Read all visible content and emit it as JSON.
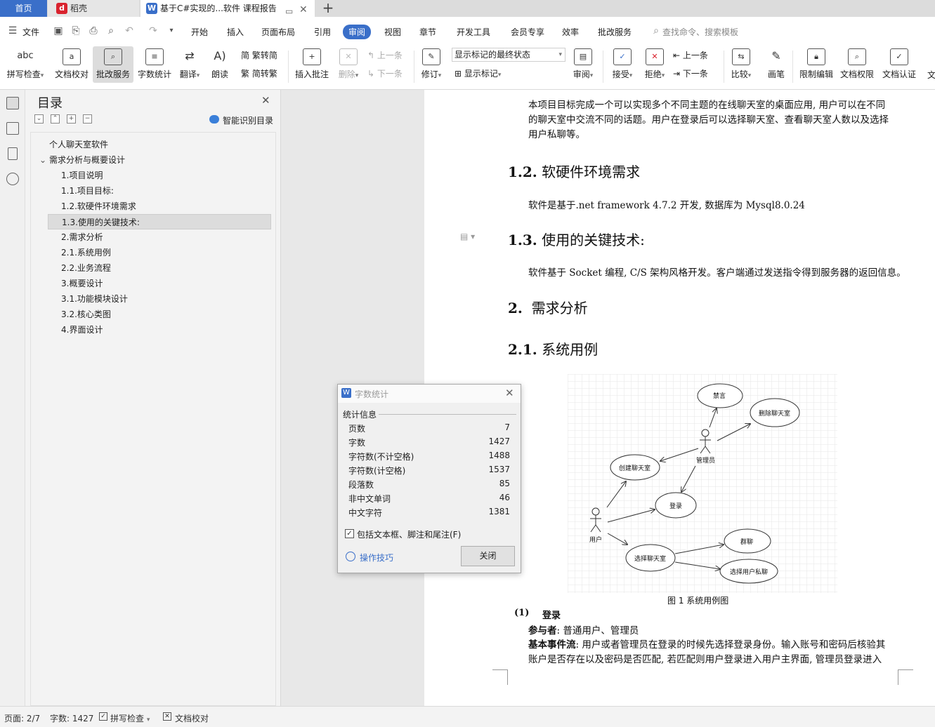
{
  "tabs": {
    "home": "首页",
    "daoke": "稻壳",
    "doc": "基于C#实现的...软件 课程报告"
  },
  "menu": {
    "file": "文件",
    "items": [
      "开始",
      "插入",
      "页面布局",
      "引用",
      "审阅",
      "视图",
      "章节",
      "开发工具",
      "会员专享",
      "效率",
      "批改服务"
    ],
    "search": "查找命令、搜索模板"
  },
  "ribbon": {
    "spell": "拼写检查",
    "proof": "文档校对",
    "review_service": "批改服务",
    "word_count": "字数统计",
    "translate": "翻译",
    "read": "朗读",
    "trad_to_simp": "繁转简",
    "simp_to_trad": "简转繁",
    "insert_comment": "插入批注",
    "delete": "删除",
    "prev": "上一条",
    "next": "下一条",
    "revise": "修订",
    "markup_state": "显示标记的最终状态",
    "show_markup": "显示标记",
    "review_pane": "审阅",
    "accept": "接受",
    "reject": "拒绝",
    "prev2": "上一条",
    "next2": "下一条",
    "compare": "比较",
    "pen": "画笔",
    "restrict": "限制编辑",
    "perm": "文档权限",
    "cert": "文档认证",
    "more": "文"
  },
  "toc": {
    "title": "目录",
    "smart": "智能识别目录",
    "items": [
      {
        "label": "个人聊天室软件",
        "level": 0
      },
      {
        "label": "需求分析与概要设计",
        "level": 0
      },
      {
        "label": "1.项目说明",
        "level": 1
      },
      {
        "label": "1.1.项目目标:",
        "level": 1
      },
      {
        "label": "1.2.软硬件环境需求",
        "level": 1
      },
      {
        "label": "1.3.使用的关键技术:",
        "level": 1
      },
      {
        "label": "2.需求分析",
        "level": 1
      },
      {
        "label": "2.1.系统用例",
        "level": 1
      },
      {
        "label": "2.2.业务流程",
        "level": 1
      },
      {
        "label": "3.概要设计",
        "level": 1
      },
      {
        "label": "3.1.功能模块设计",
        "level": 1
      },
      {
        "label": "3.2.核心类图",
        "level": 1
      },
      {
        "label": "4.界面设计",
        "level": 1
      }
    ]
  },
  "document": {
    "p1_l1": "本项目目标完成一个可以实现多个不同主题的在线聊天室的桌面应用, 用户可以在不同",
    "p1_l2": "的聊天室中交流不同的话题。用户在登录后可以选择聊天室、查看聊天室人数以及选择",
    "p1_l3": "用户私聊等。",
    "h12_num": "1.2.",
    "h12_text": "软硬件环境需求",
    "p2": "软件是基于.net framework 4.7.2 开发,  数据库为 Mysql8.0.24",
    "h13_num": "1.3.",
    "h13_text": "使用的关键技术:",
    "p3": "软件基于 Socket 编程, C/S 架构风格开发。客户端通过发送指令得到服务器的返回信息。",
    "h2_num": "2.",
    "h2_text": "需求分析",
    "h21_num": "2.1.",
    "h21_text": "系统用例",
    "figure_caption": "图  1  系统用例图",
    "login_num": "(1)",
    "login_title": "登录",
    "participants_label": "参与者",
    "participants": ":  普通用户、管理员",
    "basic_flow_label": "基本事件流",
    "basic_flow_l1": ": 用户或者管理员在登录的时候先选择登录身份。输入账号和密码后核验其",
    "basic_flow_l2": "账户是否存在以及密码是否匹配, 若匹配则用户登录进入用户主界面, 管理员登录进入"
  },
  "diagram": {
    "actors": [
      "管理员",
      "用户"
    ],
    "usecases": [
      "禁言",
      "删除聊天室",
      "创建聊天室",
      "登录",
      "选择聊天室",
      "群聊",
      "选择用户私聊"
    ]
  },
  "dialog": {
    "title": "字数统计",
    "section": "统计信息",
    "rows": [
      {
        "label": "页数",
        "value": "7"
      },
      {
        "label": "字数",
        "value": "1427"
      },
      {
        "label": "字符数(不计空格)",
        "value": "1488"
      },
      {
        "label": "字符数(计空格)",
        "value": "1537"
      },
      {
        "label": "段落数",
        "value": "85"
      },
      {
        "label": "非中文单词",
        "value": "46"
      },
      {
        "label": "中文字符",
        "value": "1381"
      }
    ],
    "checkbox": "包括文本框、脚注和尾注(F)",
    "tips": "操作技巧",
    "close": "关闭"
  },
  "status": {
    "page": "页面: 2/7",
    "words": "字数: 1427",
    "spell": "拼写检查",
    "proof": "文档校对"
  }
}
